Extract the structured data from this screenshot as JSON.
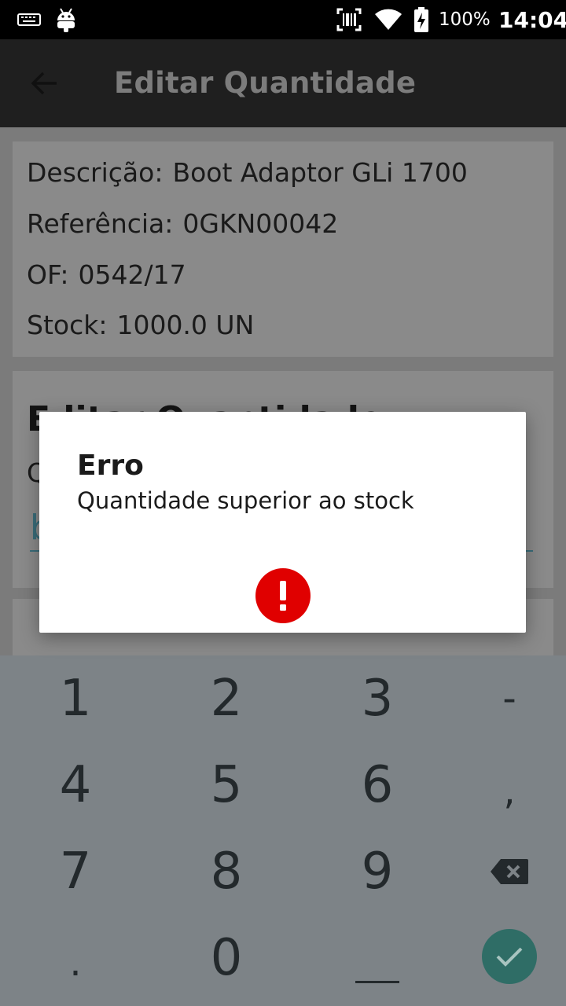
{
  "status_bar": {
    "battery_percent": "100%",
    "time": "14:04"
  },
  "app_bar": {
    "title": "Editar Quantidade"
  },
  "info": {
    "descricao_label": "Descrição:",
    "descricao_value": "Boot Adaptor GLi 1700",
    "referencia_label": "Referência:",
    "referencia_value": "0GKN00042",
    "of_label": "OF:",
    "of_value": "0542/17",
    "stock_label": "Stock:",
    "stock_value": "1000.0 UN"
  },
  "edit_section": {
    "title_partial": "Editar Quantidade",
    "label_partial": "Q",
    "input_partial": "b"
  },
  "dialog": {
    "title": "Erro",
    "message": "Quantidade superior ao stock",
    "icon": "error-exclamation-icon",
    "icon_color": "#e00000"
  },
  "keypad": {
    "keys": [
      "1",
      "2",
      "3",
      "-",
      "4",
      "5",
      "6",
      ",",
      "7",
      "8",
      "9",
      "backspace",
      ".",
      "0",
      "space",
      "enter"
    ],
    "enter_color": "#2f6d66"
  }
}
